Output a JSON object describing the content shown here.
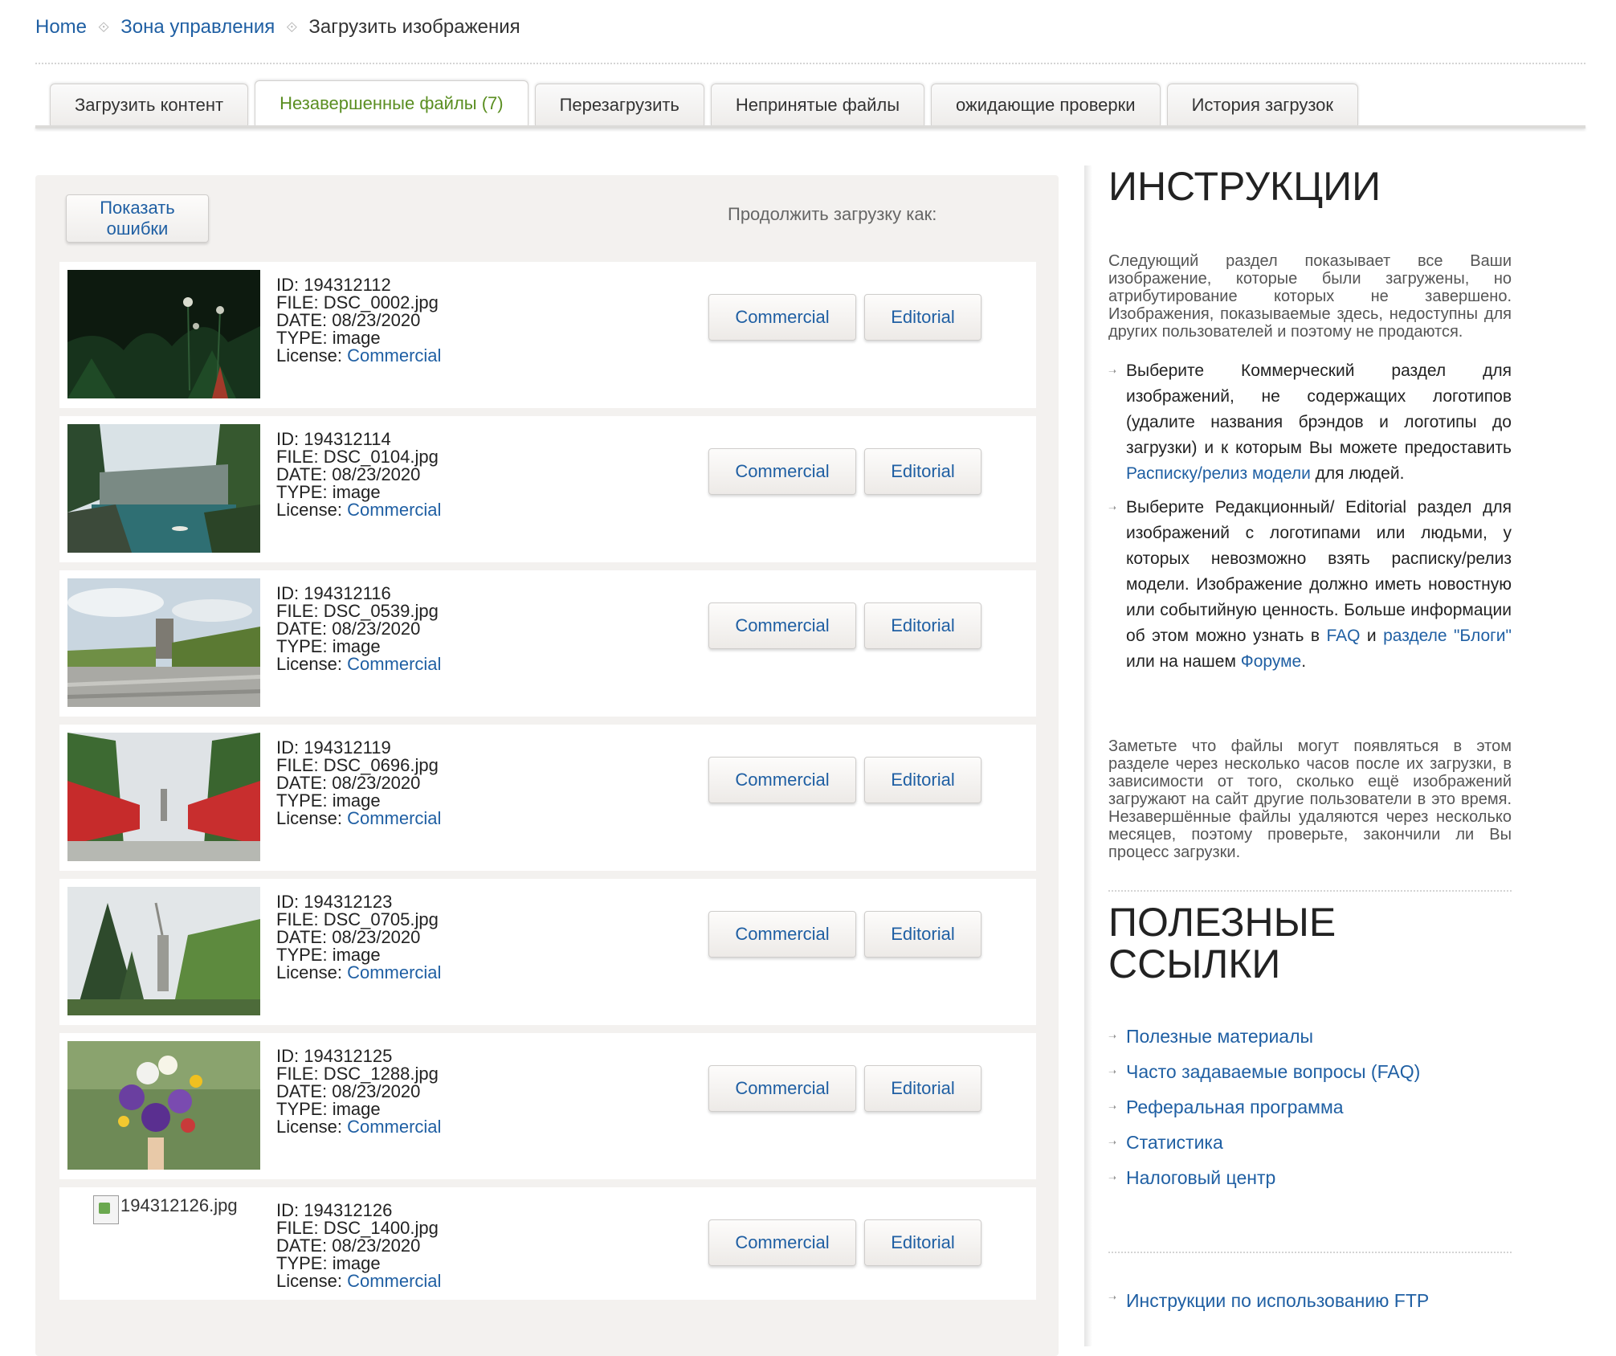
{
  "breadcrumb": {
    "home": "Home",
    "zone": "Зона управления",
    "current": "Загрузить изображения",
    "separator": "⟐"
  },
  "tabs": [
    {
      "label": "Загрузить контент"
    },
    {
      "label": "Незавершенные файлы (7)",
      "active": true
    },
    {
      "label": "Перезагрузить"
    },
    {
      "label": "Непринятые файлы"
    },
    {
      "label": "ожидающие проверки"
    },
    {
      "label": "История загрузок"
    }
  ],
  "toolbar": {
    "show_errors": "Показать ошибки",
    "continue_label": "Продолжить загрузку как:"
  },
  "labels": {
    "id": "ID:",
    "file": "FILE:",
    "date": "DATE:",
    "type": "TYPE:",
    "license": "License:",
    "commercial": "Commercial",
    "editorial": "Editorial"
  },
  "files": [
    {
      "id": "194312112",
      "file": "DSC_0002.jpg",
      "date": "08/23/2020",
      "type": "image",
      "license": "Commercial"
    },
    {
      "id": "194312114",
      "file": "DSC_0104.jpg",
      "date": "08/23/2020",
      "type": "image",
      "license": "Commercial"
    },
    {
      "id": "194312116",
      "file": "DSC_0539.jpg",
      "date": "08/23/2020",
      "type": "image",
      "license": "Commercial"
    },
    {
      "id": "194312119",
      "file": "DSC_0696.jpg",
      "date": "08/23/2020",
      "type": "image",
      "license": "Commercial"
    },
    {
      "id": "194312123",
      "file": "DSC_0705.jpg",
      "date": "08/23/2020",
      "type": "image",
      "license": "Commercial"
    },
    {
      "id": "194312125",
      "file": "DSC_1288.jpg",
      "date": "08/23/2020",
      "type": "image",
      "license": "Commercial"
    },
    {
      "id": "194312126",
      "file": "DSC_1400.jpg",
      "date": "08/23/2020",
      "type": "image",
      "license": "Commercial",
      "broken_alt": "194312126.jpg"
    }
  ],
  "sidebar": {
    "instructions_title": "ИНСТРУКЦИИ",
    "intro": "Следующий раздел показывает все Ваши изображение, которые были загружены, но атрибутирование которых не завершено. Изображения, показываемые здесь, недоступны для других пользователей и поэтому не продаются.",
    "bullet1_pre": "Выберите Коммерческий раздел для изображений, не содержащих логотипов (удалите названия брэндов и логотипы до загрузки) и к которым Вы можете предоставить ",
    "bullet1_link": "Расписку/релиз модели",
    "bullet1_post": " для людей.",
    "bullet2_pre": "Выберите Редакционный/ Editorial раздел для изображений с логотипами или людьми, у которых невозможно взять расписку/релиз модели. Изображение должно иметь новостную или событийную ценность. Больше информации об этом можно узнать в ",
    "bullet2_link1": "FAQ",
    "bullet2_mid": " и ",
    "bullet2_link2": "разделе \"Блоги\"",
    "bullet2_mid2": " или на нашем ",
    "bullet2_link3": "Форуме",
    "bullet2_post": ".",
    "note": "Заметьте что файлы могут появляться в этом разделе через несколько часов после их загрузки, в зависимости от того, сколько ещё изображений загружают на сайт другие пользователи в это время. Незавершённые файлы удаляются через несколько месяцев, поэтому проверьте, закончили ли Вы процесс загрузки.",
    "links_title_line1": "ПОЛЕЗНЫЕ",
    "links_title_line2": "ССЫЛКИ",
    "links": [
      "Полезные материалы",
      "Часто задаваемые вопросы (FAQ)",
      "Реферальная программа",
      "Статистика",
      "Налоговый центр"
    ],
    "ftp": "Инструкции по использованию FTP"
  }
}
